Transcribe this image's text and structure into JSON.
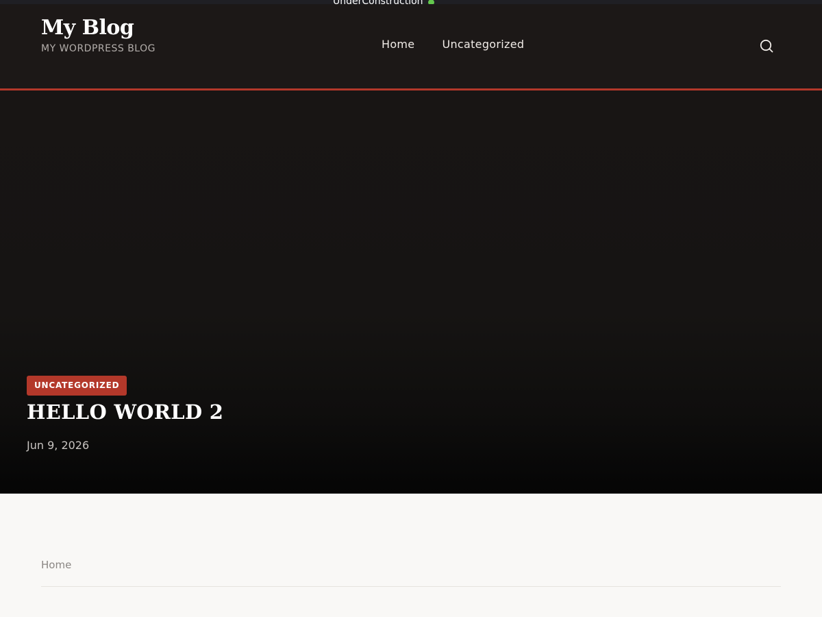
{
  "status": {
    "label": "UnderConstruction",
    "dot_color": "#63c74d"
  },
  "header": {
    "site_title": "My Blog",
    "tagline": "MY WORDPRESS BLOG",
    "nav": [
      {
        "label": "Home"
      },
      {
        "label": "Uncategorized"
      }
    ],
    "search_icon": "search-icon",
    "accent_color": "#b3382a"
  },
  "hero": {
    "category": "UNCATEGORIZED",
    "title": "HELLO WORLD 2",
    "date": "Jun 9, 2026"
  },
  "breadcrumb": {
    "home_label": "Home"
  }
}
